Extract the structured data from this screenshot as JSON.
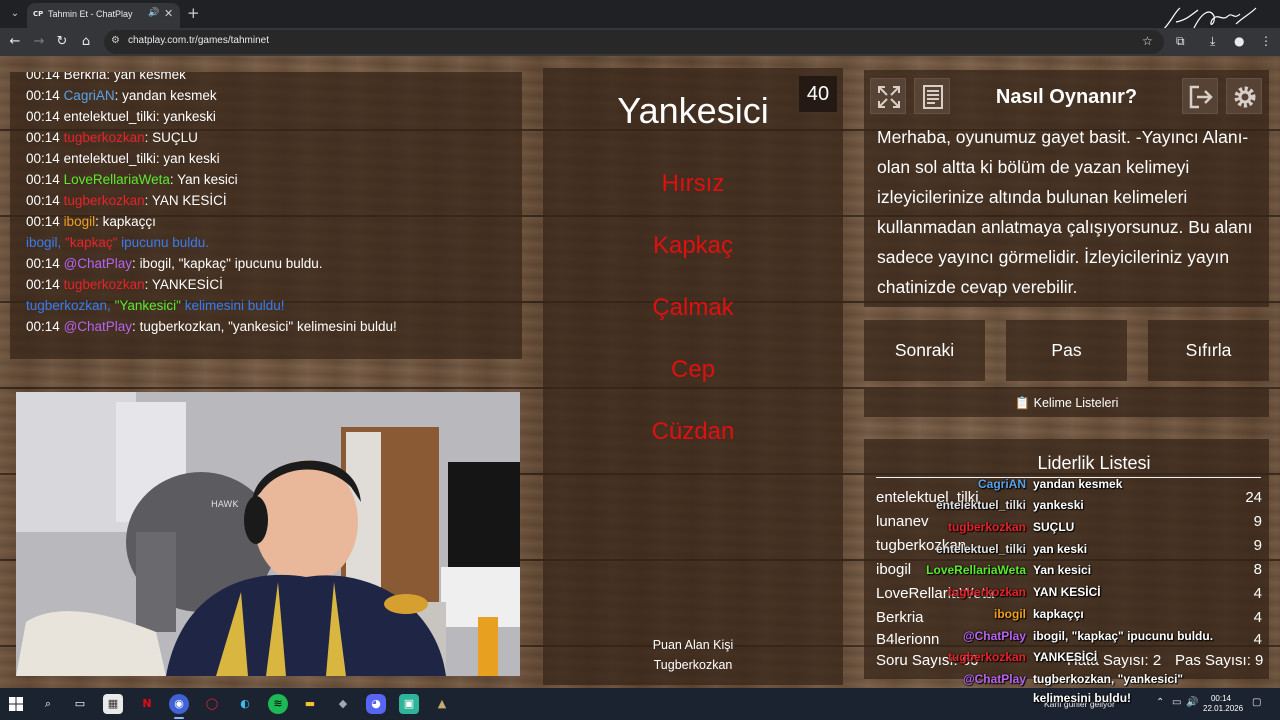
{
  "browser": {
    "tab_title": "Tahmin Et - ChatPlay",
    "tab_favicon": "CP",
    "url": "chatplay.com.tr/games/tahminet",
    "signature": "K. Atatürk"
  },
  "chat": {
    "lines": [
      {
        "time": "00:14",
        "user": "Berkria",
        "user_color": "#ffffff",
        "message": "yan kesmek"
      },
      {
        "time": "00:14",
        "user": "CagriAN",
        "user_color": "#5aa2e8",
        "message": "yandan kesmek"
      },
      {
        "time": "00:14",
        "user": "entelektuel_tilki",
        "user_color": "#ffffff",
        "message": "yankeski"
      },
      {
        "time": "00:14",
        "user": "tugberkozkan",
        "user_color": "#e8222a",
        "message": "SUÇLU"
      },
      {
        "time": "00:14",
        "user": "entelektuel_tilki",
        "user_color": "#ffffff",
        "message": "yan keski"
      },
      {
        "time": "00:14",
        "user": "LoveRellariaWeta",
        "user_color": "#59ea2e",
        "message": "Yan kesici"
      },
      {
        "time": "00:14",
        "user": "tugberkozkan",
        "user_color": "#e8222a",
        "message": "YAN KESİCİ"
      },
      {
        "time": "00:14",
        "user": "ibogil",
        "user_color": "#f0a020",
        "message": "kapkaççı"
      },
      {
        "time": "00:14",
        "user": "@ChatPlay",
        "user_color": "#b864f0",
        "message": "ibogil, \"kapkaç\" ipucunu buldu."
      },
      {
        "time": "00:14",
        "user": "tugberkozkan",
        "user_color": "#e8222a",
        "message": "YANKESİCİ"
      },
      {
        "time": "00:14",
        "user": "@ChatPlay",
        "user_color": "#b864f0",
        "message": "tugberkozkan, \"yankesici\" kelimesini buldu!"
      }
    ],
    "system_1": {
      "user": "ibogil,",
      "hint": "\"kapkaç\"",
      "text": "ipucunu buldu."
    },
    "system_2": {
      "user": "tugberkozkan,",
      "word": "\"Yankesici\"",
      "text": "kelimesini buldu!"
    }
  },
  "card": {
    "timer": "40",
    "word": "Yankesici",
    "taboo_words": [
      "Hırsız",
      "Kapkaç",
      "Çalmak",
      "Cep",
      "Cüzdan"
    ],
    "scorer_label": "Puan Alan Kişi",
    "scorer_name": "Tugberkozkan"
  },
  "instructions": {
    "title": "Nasıl Oynanır?",
    "text": "Merhaba, oyunumuz gayet basit. -Yayıncı Alanı- olan sol altta ki bölüm de yazan kelimeyi izleyicilerinize altında bulunan kelimeleri kullanmadan anlatmaya çalışıyorsunuz. Bu alanı sadece yayıncı görmelidir. İzleyicileriniz yayın chatinizde cevap verebilir."
  },
  "controls": {
    "next": "Sonraki",
    "pass": "Pas",
    "reset": "Sıfırla",
    "word_lists": "Kelime Listeleri"
  },
  "leaderboard": {
    "title": "Liderlik Listesi",
    "rows": [
      {
        "name": "entelektuel_tilki",
        "score": "24"
      },
      {
        "name": "lunanev",
        "score": "9"
      },
      {
        "name": "tugberkozkan",
        "score": "9"
      },
      {
        "name": "ibogil",
        "score": "8"
      },
      {
        "name": "LoveRellariaWeta",
        "score": "4"
      },
      {
        "name": "Berkria",
        "score": "4"
      },
      {
        "name": "B4lerionn",
        "score": "4"
      }
    ],
    "question_count": "Soru Sayısı: 60",
    "right_count": "Hata Sayısı: 2",
    "pass_count": "Pas Sayısı: 9"
  },
  "overlay_chat": [
    {
      "user": "CagriAN",
      "color": "#5aa2e8",
      "message": "yandan kesmek"
    },
    {
      "user": "entelektuel_tilki",
      "color": "#e0e0e0",
      "message": "yankeski"
    },
    {
      "user": "tugberkozkan",
      "color": "#e8222a",
      "message": "SUÇLU"
    },
    {
      "user": "entelektuel_tilki",
      "color": "#e0e0e0",
      "message": "yan keski"
    },
    {
      "user": "LoveRellariaWeta",
      "color": "#59ea2e",
      "message": "Yan kesici"
    },
    {
      "user": "tugberkozkan",
      "color": "#e8222a",
      "message": "YAN KESİCİ"
    },
    {
      "user": "ibogil",
      "color": "#f0a020",
      "message": "kapkaççı"
    },
    {
      "user": "@ChatPlay",
      "color": "#b864f0",
      "message": "ibogil, \"kapkaç\" ipucunu buldu."
    },
    {
      "user": "tugberkozkan",
      "color": "#e8222a",
      "message": "YANKESİCİ"
    },
    {
      "user": "@ChatPlay",
      "color": "#b864f0",
      "message": "tugberkozkan, \"yankesici\""
    },
    {
      "user": "",
      "color": "#ffffff",
      "message": "kelimesini buldu!"
    }
  ],
  "taskbar": {
    "weather": "Karlı günler geliyor",
    "time": "00:14",
    "date": "22.01.2026",
    "apps": [
      "start-icon",
      "search-icon",
      "task-view-icon",
      "store-icon",
      "netflix-icon",
      "chrome-icon",
      "opera-icon",
      "edge-icon",
      "spotify-icon",
      "file-explorer-icon",
      "app-icon",
      "discord-icon",
      "app2-icon",
      "league-icon"
    ]
  }
}
